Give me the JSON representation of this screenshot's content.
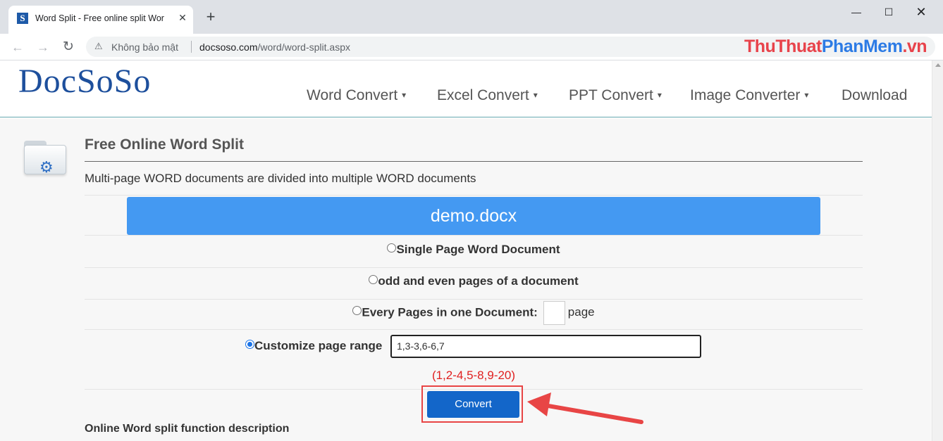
{
  "browser": {
    "tab_title": "Word Split - Free online split Wor",
    "favicon_letter": "S",
    "close_tab": "✕",
    "new_tab": "+",
    "window_buttons": {
      "minimize": "—",
      "maximize": "☐",
      "close": "✕"
    },
    "nav": {
      "back": "←",
      "forward": "→",
      "reload": "↻"
    },
    "security_label": "Không bảo mật",
    "url_host": "docsoso.com",
    "url_path": "/word/word-split.aspx",
    "watermark": {
      "part1": "ThuThuat",
      "part2": "PhanMem",
      "part3": ".vn"
    }
  },
  "site": {
    "logo": "DocSoSo",
    "nav_items": [
      {
        "label": "Word Convert",
        "has_dropdown": true
      },
      {
        "label": "Excel Convert",
        "has_dropdown": true
      },
      {
        "label": "PPT Convert",
        "has_dropdown": true
      },
      {
        "label": "Image Converter",
        "has_dropdown": true
      },
      {
        "label": "Download",
        "has_dropdown": false
      }
    ],
    "caret": "▾"
  },
  "tool": {
    "title": "Free Online Word Split",
    "subtitle": "Multi-page WORD documents are divided into multiple WORD documents",
    "file_name": "demo.docx",
    "options": {
      "single_page": {
        "label": "Single Page Word Document",
        "checked": false
      },
      "odd_even": {
        "label": "odd and even pages of a document",
        "checked": false
      },
      "every_pages": {
        "label": "Every Pages in one Document:",
        "suffix": "page",
        "value": "",
        "checked": false
      },
      "custom_range": {
        "label": "Customize page range",
        "value": "1,3-3,6-6,7",
        "checked": true
      }
    },
    "range_hint": "(1,2-4,5-8,9-20)",
    "convert_label": "Convert",
    "description_title": "Online Word split function description"
  },
  "colors": {
    "file_bar": "#4499f2",
    "convert_button": "#1366c9",
    "hint": "#e02020",
    "highlight": "#e84545",
    "logo": "#1d4f9c"
  },
  "icons": {
    "folder": "folder-settings-icon",
    "gear": "⚙",
    "lock": "⚠"
  }
}
